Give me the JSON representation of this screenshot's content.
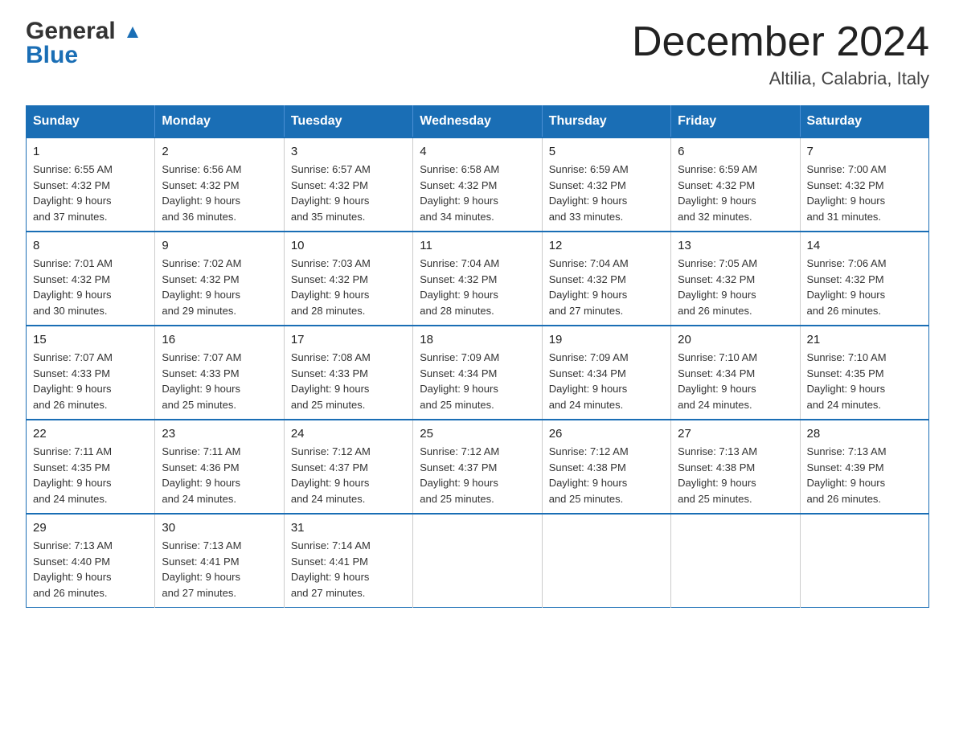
{
  "header": {
    "logo_general": "General",
    "logo_blue": "Blue",
    "title": "December 2024",
    "subtitle": "Altilia, Calabria, Italy"
  },
  "calendar": {
    "days_of_week": [
      "Sunday",
      "Monday",
      "Tuesday",
      "Wednesday",
      "Thursday",
      "Friday",
      "Saturday"
    ],
    "weeks": [
      [
        {
          "day": "1",
          "sunrise": "6:55 AM",
          "sunset": "4:32 PM",
          "daylight": "9 hours and 37 minutes."
        },
        {
          "day": "2",
          "sunrise": "6:56 AM",
          "sunset": "4:32 PM",
          "daylight": "9 hours and 36 minutes."
        },
        {
          "day": "3",
          "sunrise": "6:57 AM",
          "sunset": "4:32 PM",
          "daylight": "9 hours and 35 minutes."
        },
        {
          "day": "4",
          "sunrise": "6:58 AM",
          "sunset": "4:32 PM",
          "daylight": "9 hours and 34 minutes."
        },
        {
          "day": "5",
          "sunrise": "6:59 AM",
          "sunset": "4:32 PM",
          "daylight": "9 hours and 33 minutes."
        },
        {
          "day": "6",
          "sunrise": "6:59 AM",
          "sunset": "4:32 PM",
          "daylight": "9 hours and 32 minutes."
        },
        {
          "day": "7",
          "sunrise": "7:00 AM",
          "sunset": "4:32 PM",
          "daylight": "9 hours and 31 minutes."
        }
      ],
      [
        {
          "day": "8",
          "sunrise": "7:01 AM",
          "sunset": "4:32 PM",
          "daylight": "9 hours and 30 minutes."
        },
        {
          "day": "9",
          "sunrise": "7:02 AM",
          "sunset": "4:32 PM",
          "daylight": "9 hours and 29 minutes."
        },
        {
          "day": "10",
          "sunrise": "7:03 AM",
          "sunset": "4:32 PM",
          "daylight": "9 hours and 28 minutes."
        },
        {
          "day": "11",
          "sunrise": "7:04 AM",
          "sunset": "4:32 PM",
          "daylight": "9 hours and 28 minutes."
        },
        {
          "day": "12",
          "sunrise": "7:04 AM",
          "sunset": "4:32 PM",
          "daylight": "9 hours and 27 minutes."
        },
        {
          "day": "13",
          "sunrise": "7:05 AM",
          "sunset": "4:32 PM",
          "daylight": "9 hours and 26 minutes."
        },
        {
          "day": "14",
          "sunrise": "7:06 AM",
          "sunset": "4:32 PM",
          "daylight": "9 hours and 26 minutes."
        }
      ],
      [
        {
          "day": "15",
          "sunrise": "7:07 AM",
          "sunset": "4:33 PM",
          "daylight": "9 hours and 26 minutes."
        },
        {
          "day": "16",
          "sunrise": "7:07 AM",
          "sunset": "4:33 PM",
          "daylight": "9 hours and 25 minutes."
        },
        {
          "day": "17",
          "sunrise": "7:08 AM",
          "sunset": "4:33 PM",
          "daylight": "9 hours and 25 minutes."
        },
        {
          "day": "18",
          "sunrise": "7:09 AM",
          "sunset": "4:34 PM",
          "daylight": "9 hours and 25 minutes."
        },
        {
          "day": "19",
          "sunrise": "7:09 AM",
          "sunset": "4:34 PM",
          "daylight": "9 hours and 24 minutes."
        },
        {
          "day": "20",
          "sunrise": "7:10 AM",
          "sunset": "4:34 PM",
          "daylight": "9 hours and 24 minutes."
        },
        {
          "day": "21",
          "sunrise": "7:10 AM",
          "sunset": "4:35 PM",
          "daylight": "9 hours and 24 minutes."
        }
      ],
      [
        {
          "day": "22",
          "sunrise": "7:11 AM",
          "sunset": "4:35 PM",
          "daylight": "9 hours and 24 minutes."
        },
        {
          "day": "23",
          "sunrise": "7:11 AM",
          "sunset": "4:36 PM",
          "daylight": "9 hours and 24 minutes."
        },
        {
          "day": "24",
          "sunrise": "7:12 AM",
          "sunset": "4:37 PM",
          "daylight": "9 hours and 24 minutes."
        },
        {
          "day": "25",
          "sunrise": "7:12 AM",
          "sunset": "4:37 PM",
          "daylight": "9 hours and 25 minutes."
        },
        {
          "day": "26",
          "sunrise": "7:12 AM",
          "sunset": "4:38 PM",
          "daylight": "9 hours and 25 minutes."
        },
        {
          "day": "27",
          "sunrise": "7:13 AM",
          "sunset": "4:38 PM",
          "daylight": "9 hours and 25 minutes."
        },
        {
          "day": "28",
          "sunrise": "7:13 AM",
          "sunset": "4:39 PM",
          "daylight": "9 hours and 26 minutes."
        }
      ],
      [
        {
          "day": "29",
          "sunrise": "7:13 AM",
          "sunset": "4:40 PM",
          "daylight": "9 hours and 26 minutes."
        },
        {
          "day": "30",
          "sunrise": "7:13 AM",
          "sunset": "4:41 PM",
          "daylight": "9 hours and 27 minutes."
        },
        {
          "day": "31",
          "sunrise": "7:14 AM",
          "sunset": "4:41 PM",
          "daylight": "9 hours and 27 minutes."
        },
        null,
        null,
        null,
        null
      ]
    ],
    "labels": {
      "sunrise": "Sunrise: ",
      "sunset": "Sunset: ",
      "daylight": "Daylight: "
    }
  }
}
